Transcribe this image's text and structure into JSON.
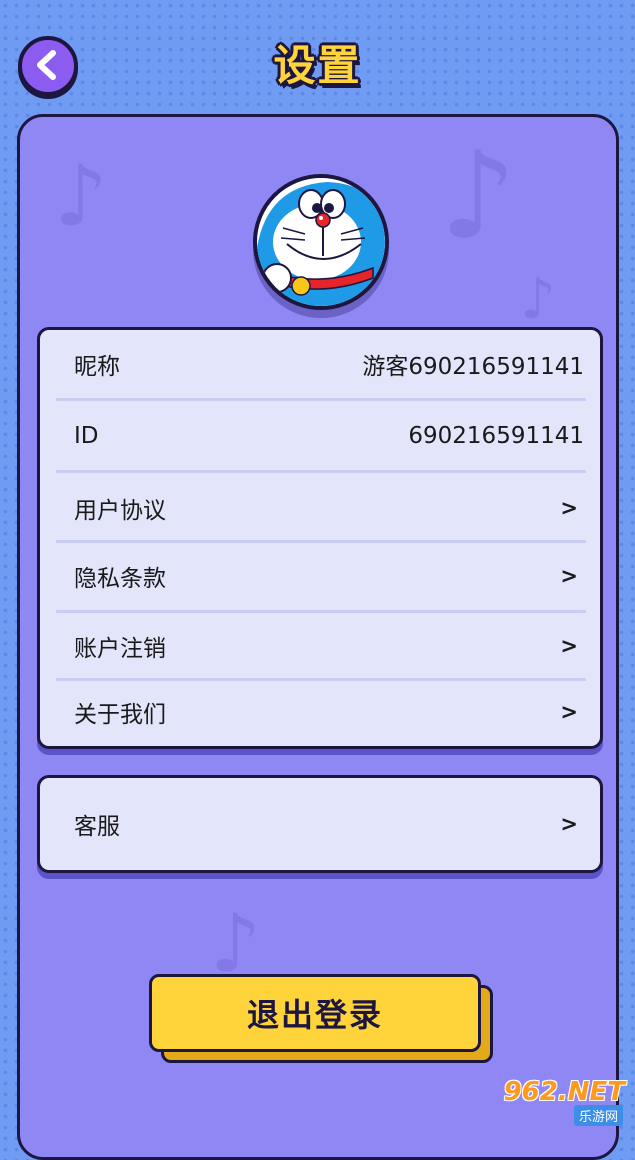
{
  "header": {
    "title": "设置",
    "back_icon": "chevron-left-icon"
  },
  "profile": {
    "avatar_icon": "doraemon-avatar"
  },
  "info_card": {
    "rows": [
      {
        "label": "昵称",
        "value": "游客690216591141"
      },
      {
        "label": "ID",
        "value": "690216591141"
      },
      {
        "label": "用户协议",
        "value": ">"
      },
      {
        "label": "隐私条款",
        "value": ">"
      },
      {
        "label": "账户注销",
        "value": ">"
      },
      {
        "label": "关于我们",
        "value": ">"
      }
    ]
  },
  "service_card": {
    "rows": [
      {
        "label": "客服",
        "value": ">"
      }
    ]
  },
  "logout": {
    "label": "退出登录"
  },
  "watermark": {
    "main": "962.NET",
    "sub": "乐游网"
  },
  "colors": {
    "background": "#6f9cf2",
    "panel": "#8e87f4",
    "card": "#e3e6fb",
    "accent_yellow": "#ffd43a",
    "outline": "#1c1640",
    "back_button": "#8c5cf0"
  }
}
